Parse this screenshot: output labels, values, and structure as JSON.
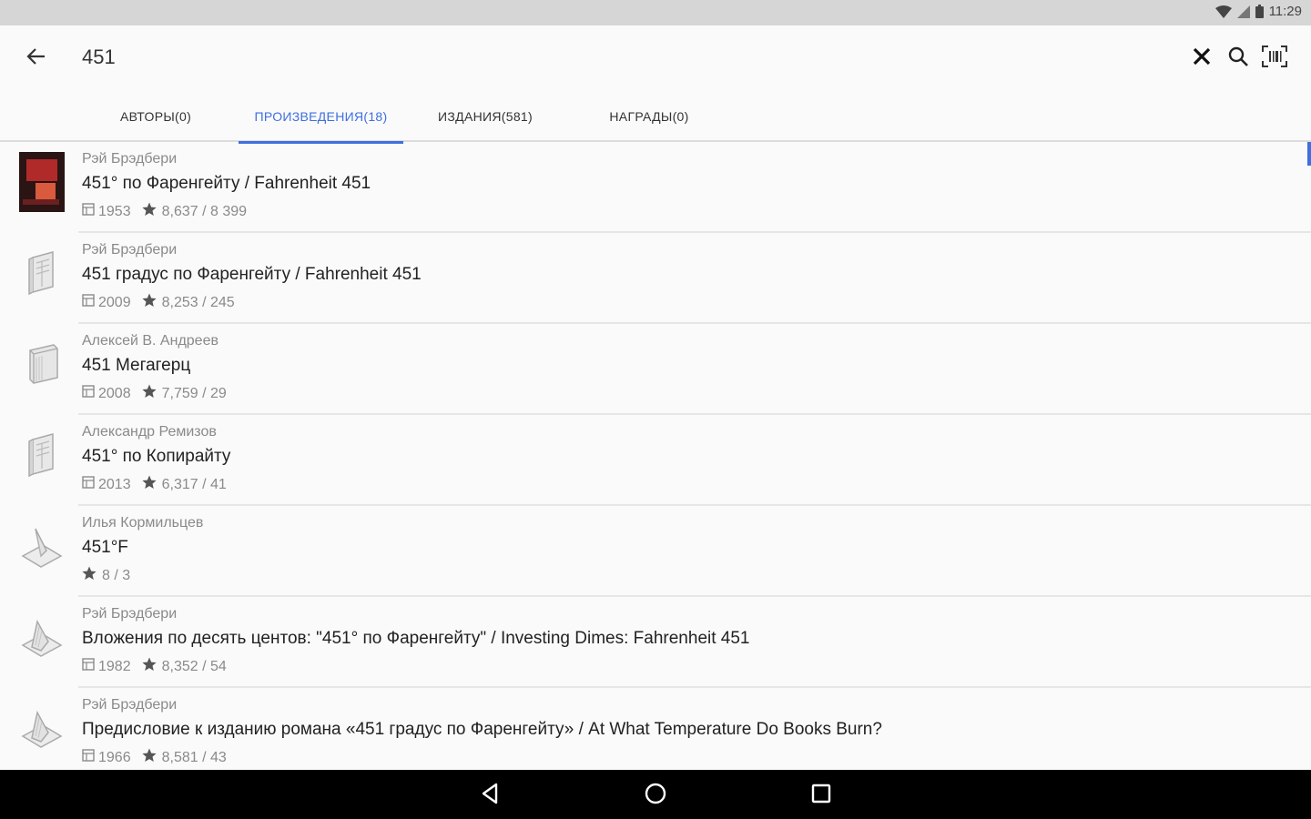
{
  "status": {
    "time": "11:29"
  },
  "toolbar": {
    "query": "451"
  },
  "tabs": [
    {
      "label": "АВТОРЫ(0)"
    },
    {
      "label": "ПРОИЗВЕДЕНИЯ(18)"
    },
    {
      "label": "ИЗДАНИЯ(581)"
    },
    {
      "label": "НАГРАДЫ(0)"
    }
  ],
  "accent_color": "#3f6fe0",
  "items": [
    {
      "author": "Рэй Брэдбери",
      "title": "451° по Фаренгейту / Fahrenheit 451",
      "year": "1953",
      "rating": "8,637 / 8 399",
      "thumb": "book-cover"
    },
    {
      "author": "Рэй Брэдбери",
      "title": "451 градус по Фаренгейту / Fahrenheit 451",
      "year": "2009",
      "rating": "8,253 / 245",
      "thumb": "book-icon"
    },
    {
      "author": "Алексей В. Андреев",
      "title": "451 Мегагерц",
      "year": "2008",
      "rating": "7,759 / 29",
      "thumb": "stack-icon"
    },
    {
      "author": "Александр Ремизов",
      "title": "451° по Копирайту",
      "year": "2013",
      "rating": "6,317 / 41",
      "thumb": "book-icon"
    },
    {
      "author": "Илья Кормильцев",
      "title": "451°F",
      "year": "",
      "rating": "8 / 3",
      "thumb": "leaf-icon"
    },
    {
      "author": "Рэй Брэдбери",
      "title": "Вложения по десять центов: \"451° по Фаренгейту\" / Investing Dimes: Fahrenheit 451",
      "year": "1982",
      "rating": "8,352 / 54",
      "thumb": "open-page-icon"
    },
    {
      "author": "Рэй Брэдбери",
      "title": "Предисловие к изданию романа «451 градус по Фаренгейту» / At What Temperature Do Books Burn?",
      "year": "1966",
      "rating": "8,581 / 43",
      "thumb": "open-page-icon"
    }
  ]
}
